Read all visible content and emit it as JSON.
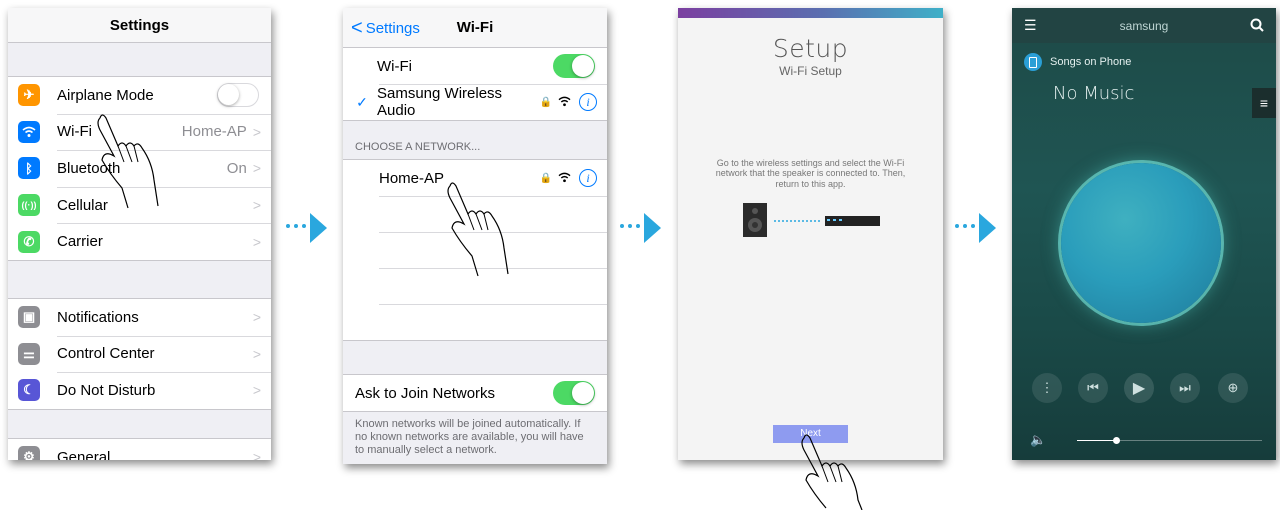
{
  "settings_screen": {
    "title": "Settings",
    "group1": [
      {
        "label": "Airplane Mode",
        "detail": "",
        "icon": "airplane-icon",
        "color": "#ff9500"
      },
      {
        "label": "Wi-Fi",
        "detail": "Home-AP",
        "icon": "wifi-icon",
        "color": "#007aff"
      },
      {
        "label": "Bluetooth",
        "detail": "On",
        "icon": "bluetooth-icon",
        "color": "#007aff"
      },
      {
        "label": "Cellular",
        "detail": "",
        "icon": "cellular-icon",
        "color": "#4cd964"
      },
      {
        "label": "Carrier",
        "detail": "",
        "icon": "phone-icon",
        "color": "#4cd964"
      }
    ],
    "group2": [
      {
        "label": "Notifications",
        "icon": "notifications-icon",
        "color": "#8e8e93"
      },
      {
        "label": "Control Center",
        "icon": "control-center-icon",
        "color": "#8e8e93"
      },
      {
        "label": "Do Not Disturb",
        "icon": "moon-icon",
        "color": "#5856d6"
      }
    ],
    "group3": [
      {
        "label": "General",
        "icon": "gear-icon",
        "color": "#8e8e93"
      }
    ]
  },
  "wifi_screen": {
    "back_label": "Settings",
    "title": "Wi-Fi",
    "wifi_label": "Wi-Fi",
    "connected_network": "Samsung Wireless Audio",
    "section_header": "CHOOSE A NETWORK...",
    "network": "Home-AP",
    "ask_label": "Ask to Join Networks",
    "footnote": "Known networks will be joined automatically. If no known networks are available, you will have to manually select a network."
  },
  "setup_screen": {
    "title": "Setup",
    "subtitle": "Wi-Fi Setup",
    "instructions": "Go to the wireless settings and select the Wi-Fi network that the speaker is connected to. Then, return to this app.",
    "next_label": "Next"
  },
  "music_screen": {
    "speaker_name": "samsung",
    "source_label": "Songs on Phone",
    "status": "No Music",
    "volume_level": 0.21
  },
  "colors": {
    "accent_blue": "#2aa7de",
    "ios_blue": "#007aff",
    "toggle_green": "#4cd964"
  }
}
